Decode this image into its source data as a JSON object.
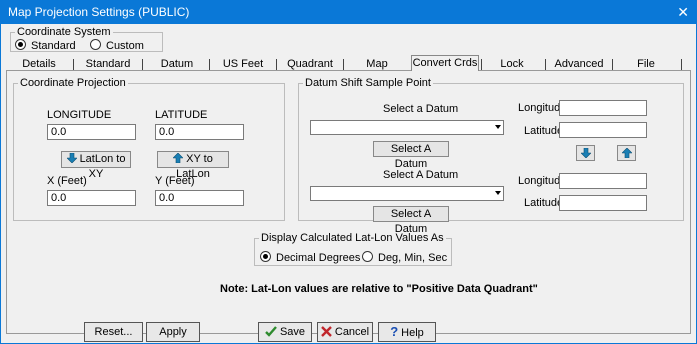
{
  "window": {
    "title": "Map Projection Settings (PUBLIC)",
    "close_glyph": "✕"
  },
  "coordinate_system": {
    "legend": "Coordinate System",
    "options": [
      {
        "label": "Standard",
        "selected": true
      },
      {
        "label": "Custom",
        "selected": false
      }
    ]
  },
  "tabs": [
    {
      "label": "Details"
    },
    {
      "label": "Standard"
    },
    {
      "label": "Datum"
    },
    {
      "label": "US Feet"
    },
    {
      "label": "Quadrant"
    },
    {
      "label": "Map Rotation"
    },
    {
      "label": "Convert Crds",
      "selected": true
    },
    {
      "label": "Lock"
    },
    {
      "label": "Advanced"
    },
    {
      "label": "File"
    }
  ],
  "coord_projection": {
    "legend": "Coordinate Projection",
    "longitude_label": "LONGITUDE",
    "latitude_label": "LATITUDE",
    "longitude_value": "0.0",
    "latitude_value": "0.0",
    "latlon_to_xy": "LatLon to XY",
    "xy_to_latlon": "XY to LatLon",
    "x_label": "X (Feet)",
    "y_label": "Y (Feet)",
    "x_value": "0.0",
    "y_value": "0.0"
  },
  "datum_shift": {
    "legend": "Datum Shift Sample Point",
    "select_datum_label_1": "Select a Datum",
    "select_datum_button_1": "Select A Datum",
    "select_datum_label_2": "Select A Datum",
    "select_datum_button_2": "Select A Datum",
    "longitude_label": "Longitude",
    "latitude_label": "Latitude",
    "longitude_value_1": "",
    "latitude_value_1": "",
    "longitude_value_2": "",
    "latitude_value_2": "",
    "down_icon": "down-arrow-icon",
    "up_icon": "up-arrow-icon"
  },
  "display_values": {
    "legend": "Display Calculated Lat-Lon Values As",
    "options": [
      {
        "label": "Decimal Degrees",
        "selected": true
      },
      {
        "label": "Deg, Min, Sec",
        "selected": false
      }
    ]
  },
  "note": "Note: Lat-Lon values are relative to \"Positive Data Quadrant\"",
  "buttons": {
    "reset": "Reset...",
    "apply": "Apply",
    "save": "Save",
    "cancel": "Cancel",
    "help": "Help"
  },
  "colors": {
    "titlebar": "#0a78d7",
    "arrow_icon": "#1a7fb4",
    "check": "#2e8b2e",
    "cross": "#c0262c",
    "help": "#1a4fb4"
  }
}
